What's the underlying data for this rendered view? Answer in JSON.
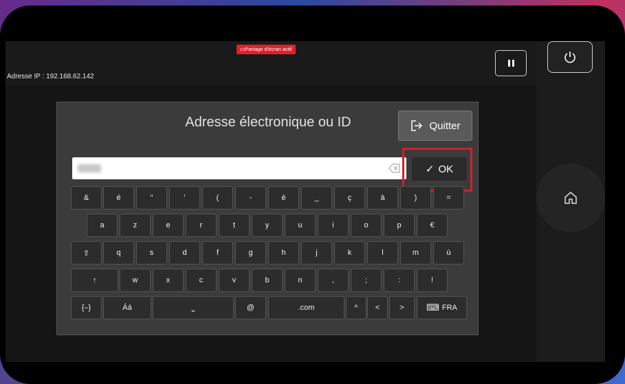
{
  "status": {
    "share_label": "Partage d'écran actif",
    "ip_label": "Adresse IP : 192.168.62.142"
  },
  "side": {
    "pause_icon": "pause-icon",
    "power_icon": "power-icon",
    "home_icon": "home-icon"
  },
  "dialog": {
    "title": "Adresse électronique ou ID",
    "quit_label": "Quitter",
    "ok_label": "OK",
    "input_value": "",
    "highlight_color": "#d0202e"
  },
  "keyboard": {
    "row1": [
      "&",
      "é",
      "\"",
      "'",
      "(",
      "-",
      "è",
      "_",
      "ç",
      "à",
      ")",
      "="
    ],
    "row2": [
      "a",
      "z",
      "e",
      "r",
      "t",
      "y",
      "u",
      "i",
      "o",
      "p",
      "€"
    ],
    "row3": [
      "⇧",
      "q",
      "s",
      "d",
      "f",
      "g",
      "h",
      "j",
      "k",
      "l",
      "m",
      "ù"
    ],
    "row4": [
      "↑",
      "w",
      "x",
      "c",
      "v",
      "b",
      "n",
      ",",
      ";",
      ":",
      "!"
    ],
    "row5": [
      "{–}",
      "Áá",
      "⎵",
      "@",
      ".com",
      "^",
      "<",
      ">",
      "FRA"
    ]
  }
}
